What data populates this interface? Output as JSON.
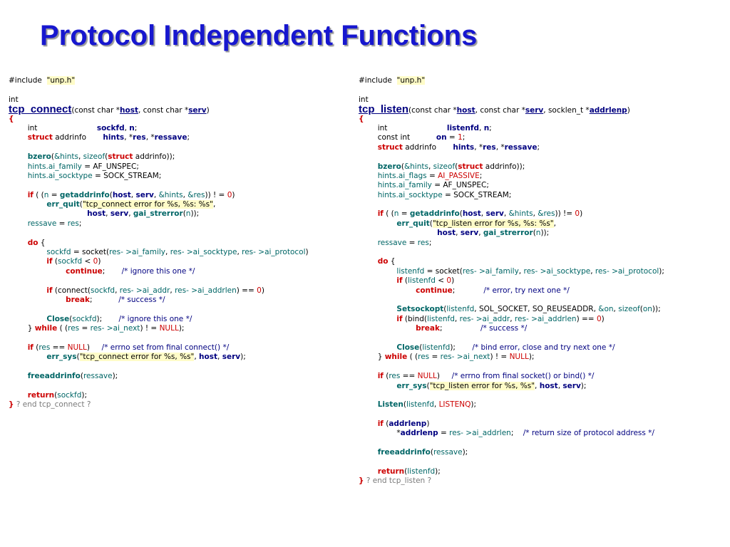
{
  "slide": {
    "title": "Protocol Independent Functions"
  },
  "left": {
    "include": "#include",
    "include_file": "\"unp.h\"",
    "ret_type": "int",
    "func_name": "tcp_connect",
    "end_comment": "? end tcp_connect ?"
  },
  "right": {
    "include": "#include",
    "include_file": "\"unp.h\"",
    "ret_type": "int",
    "func_name": "tcp_listen",
    "end_comment": "? end tcp_listen ?"
  }
}
